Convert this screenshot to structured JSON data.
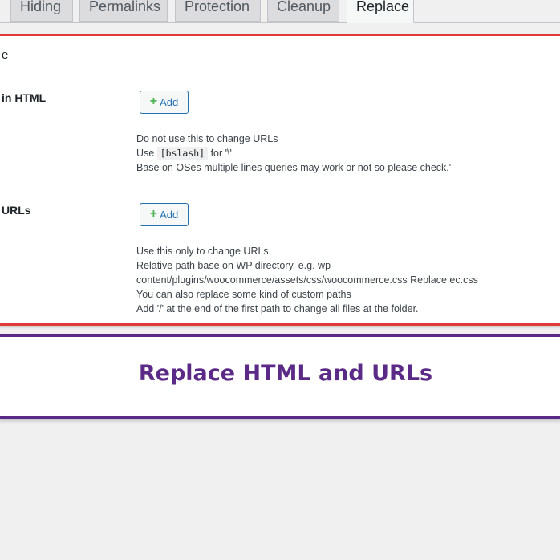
{
  "tabs": [
    {
      "label": "Hiding",
      "active": false
    },
    {
      "label": "Permalinks",
      "active": false
    },
    {
      "label": "Protection",
      "active": false
    },
    {
      "label": "Cleanup",
      "active": false
    },
    {
      "label": "Replace",
      "active": true
    }
  ],
  "section": {
    "title": "e"
  },
  "rows": [
    {
      "label": "in HTML",
      "button_label": "Add",
      "description": {
        "line1": "Do not use this to change URLs",
        "line2_prefix": "Use",
        "line2_code": "[bslash]",
        "line2_suffix": " for '\\'",
        "line3": "Base on OSes multiple lines queries may work or not so please check.'"
      }
    },
    {
      "label": "URLs",
      "button_label": "Add",
      "description": {
        "line1": "Use this only to change URLs.",
        "line2": "Relative path base on WP directory. e.g. wp-",
        "line3": "content/plugins/woocommerce/assets/css/woocommerce.css Replace ec.css",
        "line4": "You can also replace some kind of custom paths",
        "line5": "Add '/' at the end of the first path to change all files at the folder."
      }
    }
  ],
  "banner": {
    "title": "Replace HTML and URLs"
  },
  "colors": {
    "panel_border": "#e23a3a",
    "banner_border": "#5b2a86",
    "button_border": "#2271b1",
    "plus_icon": "#46b450"
  }
}
